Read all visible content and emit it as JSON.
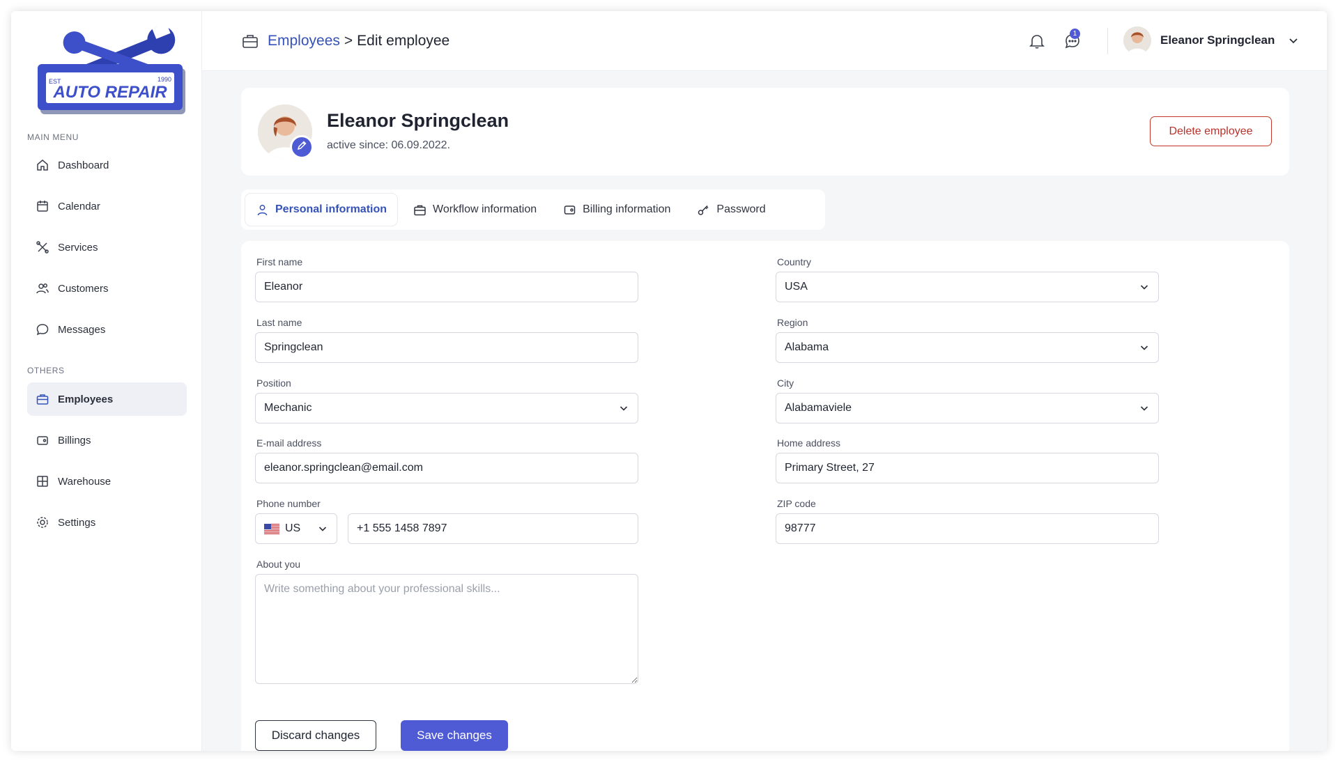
{
  "sidebar": {
    "logo": {
      "text": "AUTO REPAIR",
      "est": "EST",
      "year": "1990"
    },
    "main_menu_label": "MAIN MENU",
    "others_label": "OTHERS",
    "items": [
      {
        "label": "Dashboard",
        "icon": "home-icon"
      },
      {
        "label": "Calendar",
        "icon": "calendar-icon"
      },
      {
        "label": "Services",
        "icon": "tools-icon"
      },
      {
        "label": "Customers",
        "icon": "users-icon"
      },
      {
        "label": "Messages",
        "icon": "chat-icon"
      },
      {
        "label": "Employees",
        "icon": "briefcase-icon",
        "active": true
      },
      {
        "label": "Billings",
        "icon": "wallet-icon"
      },
      {
        "label": "Warehouse",
        "icon": "grid-icon"
      },
      {
        "label": "Settings",
        "icon": "gear-icon"
      }
    ]
  },
  "header": {
    "breadcrumb_parent": "Employees",
    "breadcrumb_sep": ">",
    "breadcrumb_current": "Edit employee",
    "notifications_icon": "bell-icon",
    "messages_icon": "chat-icon",
    "messages_badge": "1",
    "user_name": "Eleanor Springclean"
  },
  "profile": {
    "name": "Eleanor Springclean",
    "active_since": "active since: 06.09.2022.",
    "delete_label": "Delete employee"
  },
  "tabs": [
    {
      "label": "Personal information",
      "icon": "user-icon",
      "active": true
    },
    {
      "label": "Workflow information",
      "icon": "briefcase-icon"
    },
    {
      "label": "Billing information",
      "icon": "wallet-icon"
    },
    {
      "label": "Password",
      "icon": "key-icon"
    }
  ],
  "form": {
    "first_name": {
      "label": "First name",
      "value": "Eleanor"
    },
    "last_name": {
      "label": "Last name",
      "value": "Springclean"
    },
    "position": {
      "label": "Position",
      "value": "Mechanic"
    },
    "email": {
      "label": "E-mail address",
      "value": "eleanor.springclean@email.com"
    },
    "phone": {
      "label": "Phone number",
      "country_code": "US",
      "value": "+1 555 1458 7897"
    },
    "about": {
      "label": "About you",
      "placeholder": "Write something about your professional skills...",
      "value": ""
    },
    "country": {
      "label": "Country",
      "value": "USA"
    },
    "region": {
      "label": "Region",
      "value": "Alabama"
    },
    "city": {
      "label": "City",
      "value": "Alabamaviele"
    },
    "home_address": {
      "label": "Home address",
      "value": "Primary Street, 27"
    },
    "zip": {
      "label": "ZIP code",
      "value": "98777"
    },
    "discard_label": "Discard changes",
    "save_label": "Save changes"
  },
  "colors": {
    "accent": "#4f5bd5",
    "link": "#3552b8",
    "danger": "#b8322a",
    "background": "#f5f6f8"
  }
}
